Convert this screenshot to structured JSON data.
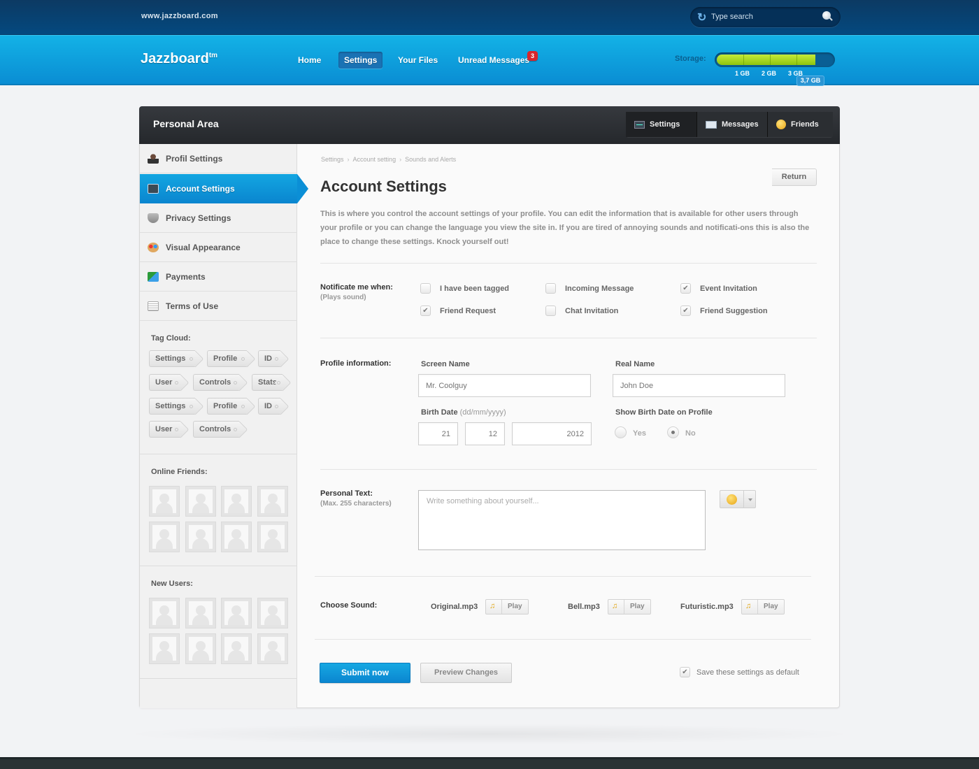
{
  "topbar": {
    "site_url": "www.jazzboard.com",
    "search_placeholder": "Type search"
  },
  "navbar": {
    "logo": "Jazzboard",
    "logo_sup": "tm",
    "items": [
      {
        "label": "Home",
        "active": false
      },
      {
        "label": "Settings",
        "active": true
      },
      {
        "label": "Your Files",
        "active": false
      },
      {
        "label": "Unread Messages",
        "active": false,
        "badge": "3"
      }
    ],
    "storage": {
      "label": "Storage:",
      "used_label": "3,7 GB",
      "used_gb": 3.7,
      "scale": [
        "1 GB",
        "2 GB",
        "3 GB"
      ],
      "fill_color": "#a6d81f"
    }
  },
  "panel": {
    "title": "Personal Area",
    "tabs": [
      {
        "label": "Settings",
        "icon": "monitor-icon"
      },
      {
        "label": "Messages",
        "icon": "mail-icon"
      },
      {
        "label": "Friends",
        "icon": "smiley-icon"
      }
    ]
  },
  "sidebar": {
    "items": [
      {
        "label": "Profil Settings",
        "icon": "user-icon",
        "active": false
      },
      {
        "label": "Account Settings",
        "icon": "monitor-icon",
        "active": true
      },
      {
        "label": "Privacy Settings",
        "icon": "shield-icon",
        "active": false
      },
      {
        "label": "Visual Appearance",
        "icon": "palette-icon",
        "active": false
      },
      {
        "label": "Payments",
        "icon": "credit-card-icon",
        "active": false
      },
      {
        "label": "Terms of Use",
        "icon": "document-icon",
        "active": false
      }
    ],
    "tag_cloud_label": "Tag Cloud:",
    "tags": [
      "Settings",
      "Profile",
      "ID",
      "User",
      "Controls",
      "Stats",
      "Settings",
      "Profile",
      "ID",
      "User",
      "Controls"
    ],
    "online_friends_label": "Online Friends:",
    "new_users_label": "New Users:"
  },
  "main": {
    "breadcrumb": [
      "Settings",
      "Account setting",
      "Sounds and Alerts"
    ],
    "return_label": "Return",
    "title": "Account Settings",
    "intro": "This is where you control the account settings of your profile. You can edit the information that is available for other users through your profile or you can change the language you view the site in. If you are tired of annoying sounds and notificati-ons this is also the place to change these settings. Knock yourself out!",
    "notify": {
      "label": "Notificate me when:",
      "sublabel": "(Plays sound)",
      "options": [
        {
          "label": "I have been tagged",
          "checked": false
        },
        {
          "label": "Incoming Message",
          "checked": false
        },
        {
          "label": "Event Invitation",
          "checked": true
        },
        {
          "label": "Friend Request",
          "checked": true
        },
        {
          "label": "Chat Invitation",
          "checked": false
        },
        {
          "label": "Friend Suggestion",
          "checked": true
        }
      ]
    },
    "profile": {
      "label": "Profile information:",
      "screen_name_label": "Screen Name",
      "screen_name_placeholder": "Mr. Coolguy",
      "real_name_label": "Real Name",
      "real_name_placeholder": "John Doe",
      "birth_label": "Birth Date",
      "birth_format": "(dd/mm/yyyy)",
      "birth_day": "21",
      "birth_month": "12",
      "birth_year": "2012",
      "show_birth_label": "Show Birth Date on Profile",
      "yes_label": "Yes",
      "no_label": "No",
      "show_birth_value": "No"
    },
    "personal_text": {
      "label": "Personal Text:",
      "sublabel": "(Max. 255 characters)",
      "placeholder": "Write something about yourself..."
    },
    "sound": {
      "label": "Choose Sound:",
      "options": [
        {
          "name": "Original.mp3",
          "play_label": "Play"
        },
        {
          "name": "Bell.mp3",
          "play_label": "Play"
        },
        {
          "name": "Futuristic.mp3",
          "play_label": "Play"
        }
      ]
    },
    "submit_label": "Submit now",
    "preview_label": "Preview Changes",
    "save_default_label": "Save these settings as default",
    "save_default_checked": true
  }
}
